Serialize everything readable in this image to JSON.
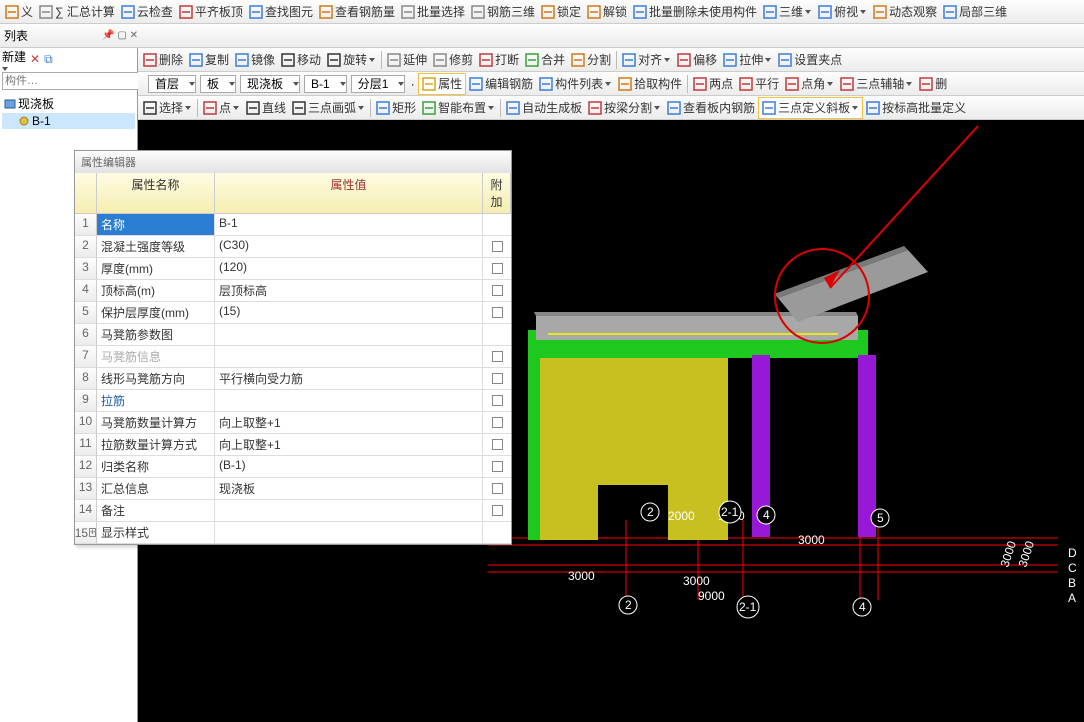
{
  "topbar": [
    {
      "label": "义",
      "iconColor": "#d07818"
    },
    {
      "label": "∑ 汇总计算"
    },
    {
      "label": "云检查",
      "iconColor": "#3b7dd8"
    },
    {
      "label": "平齐板顶",
      "iconColor": "#c23a3a"
    },
    {
      "label": "查找图元",
      "iconColor": "#3b7dd8"
    },
    {
      "label": "查看钢筋量",
      "iconColor": "#d07818"
    },
    {
      "label": "批量选择",
      "iconColor": "#888"
    },
    {
      "label": "钢筋三维",
      "iconColor": "#888"
    },
    {
      "label": "锁定",
      "iconColor": "#d07818"
    },
    {
      "label": "解锁",
      "iconColor": "#d07818"
    },
    {
      "label": "批量删除未使用构件",
      "iconColor": "#3b7dd8"
    },
    {
      "label": "三维",
      "iconColor": "#3b7dd8",
      "dd": true
    },
    {
      "label": "俯视",
      "iconColor": "#3b7dd8",
      "dd": true
    },
    {
      "label": "动态观察",
      "iconColor": "#d07818"
    },
    {
      "label": "局部三维",
      "iconColor": "#3b7dd8"
    }
  ],
  "leftPanel": {
    "title": "列表",
    "newLabel": "新建",
    "searchPlaceholder": "构件…",
    "tree": [
      {
        "label": "现浇板",
        "kind": "folder"
      },
      {
        "label": "B-1",
        "kind": "item",
        "sel": true
      }
    ]
  },
  "toolbar2": [
    {
      "label": "删除",
      "iconColor": "#c23a3a"
    },
    {
      "label": "复制",
      "iconColor": "#3b7dd8"
    },
    {
      "label": "镜像",
      "iconColor": "#3b7dd8"
    },
    {
      "label": "移动",
      "iconColor": "#333"
    },
    {
      "label": "旋转",
      "iconColor": "#333",
      "dd": true
    },
    {
      "sep": true
    },
    {
      "label": "延伸",
      "iconColor": "#888"
    },
    {
      "label": "修剪",
      "iconColor": "#888"
    },
    {
      "label": "打断",
      "iconColor": "#c23a3a"
    },
    {
      "label": "合并",
      "iconColor": "#38a038"
    },
    {
      "label": "分割",
      "iconColor": "#d07818"
    },
    {
      "sep": true
    },
    {
      "label": "对齐",
      "iconColor": "#3b7dd8",
      "dd": true
    },
    {
      "label": "偏移",
      "iconColor": "#c23a3a"
    },
    {
      "label": "拉伸",
      "iconColor": "#3b7dd8",
      "dd": true
    },
    {
      "label": "设置夹点",
      "iconColor": "#3b7dd8"
    }
  ],
  "combos": [
    "首层",
    "板",
    "现浇板",
    "B-1",
    "分层1"
  ],
  "toolbar3_right": [
    {
      "label": "属性",
      "iconColor": "#d0a818",
      "boxed": true
    },
    {
      "label": "编辑钢筋",
      "iconColor": "#3b7dd8"
    },
    {
      "label": "构件列表",
      "iconColor": "#3b7dd8",
      "dd": true
    },
    {
      "label": "拾取构件",
      "iconColor": "#d07818"
    },
    {
      "sep": true
    },
    {
      "label": "两点",
      "iconColor": "#c23a3a"
    },
    {
      "label": "平行",
      "iconColor": "#c23a3a"
    },
    {
      "label": "点角",
      "iconColor": "#c23a3a",
      "dd": true
    },
    {
      "label": "三点辅轴",
      "iconColor": "#c23a3a",
      "dd": true
    },
    {
      "label": "删",
      "iconColor": "#c23a3a"
    }
  ],
  "toolbar4": [
    {
      "label": "选择",
      "iconColor": "#333",
      "dd": true
    },
    {
      "sep": true
    },
    {
      "label": "点",
      "iconColor": "#c23a3a",
      "dd": true
    },
    {
      "label": "直线",
      "iconColor": "#333"
    },
    {
      "label": "三点画弧",
      "iconColor": "#333",
      "dd": true
    },
    {
      "sep": true
    },
    {
      "label": "矩形",
      "iconColor": "#3b7dd8"
    },
    {
      "label": "智能布置",
      "iconColor": "#38a038",
      "dd": true
    },
    {
      "sep": true
    },
    {
      "label": "自动生成板",
      "iconColor": "#3b7dd8"
    },
    {
      "label": "按梁分割",
      "iconColor": "#c23a3a",
      "dd": true
    },
    {
      "label": "查看板内钢筋",
      "iconColor": "#3b7dd8"
    },
    {
      "label": "三点定义斜板",
      "iconColor": "#3b7dd8",
      "dd": true,
      "highlight": true
    },
    {
      "label": "按标高批量定义",
      "iconColor": "#3b7dd8"
    }
  ],
  "propEditor": {
    "title": "属性编辑器",
    "headers": {
      "name": "属性名称",
      "value": "属性值",
      "extra": "附加"
    },
    "rows": [
      {
        "n": "1",
        "name": "名称",
        "value": "B-1",
        "sel": true
      },
      {
        "n": "2",
        "name": "混凝土强度等级",
        "value": "(C30)",
        "chk": true
      },
      {
        "n": "3",
        "name": "厚度(mm)",
        "value": "(120)",
        "chk": true
      },
      {
        "n": "4",
        "name": "顶标高(m)",
        "value": "层顶标高",
        "chk": true
      },
      {
        "n": "5",
        "name": "保护层厚度(mm)",
        "value": "(15)",
        "chk": true
      },
      {
        "n": "6",
        "name": "马凳筋参数图",
        "value": ""
      },
      {
        "n": "7",
        "name": "马凳筋信息",
        "value": "",
        "dim": true,
        "chk": true
      },
      {
        "n": "8",
        "name": "线形马凳筋方向",
        "value": "平行横向受力筋",
        "chk": true
      },
      {
        "n": "9",
        "name": "拉筋",
        "value": "",
        "link": true,
        "chk": true
      },
      {
        "n": "10",
        "name": "马凳筋数量计算方",
        "value": "向上取整+1",
        "chk": true
      },
      {
        "n": "11",
        "name": "拉筋数量计算方式",
        "value": "向上取整+1",
        "chk": true
      },
      {
        "n": "12",
        "name": "归类名称",
        "value": "(B-1)",
        "chk": true
      },
      {
        "n": "13",
        "name": "汇总信息",
        "value": "现浇板",
        "chk": true
      },
      {
        "n": "14",
        "name": "备注",
        "value": "",
        "chk": true
      },
      {
        "n": "15",
        "name": "显示样式",
        "value": "",
        "expand": true
      }
    ]
  },
  "model": {
    "dims": [
      "3000",
      "3000",
      "2000",
      "1000",
      "3000",
      "9000",
      "3000"
    ],
    "axisLabels": [
      "2",
      "2",
      "2-1",
      "2-1",
      "4",
      "4",
      "5"
    ],
    "rightLabels": [
      "D",
      "C",
      "B",
      "A"
    ],
    "rightDims": [
      "3000",
      "3000"
    ]
  }
}
